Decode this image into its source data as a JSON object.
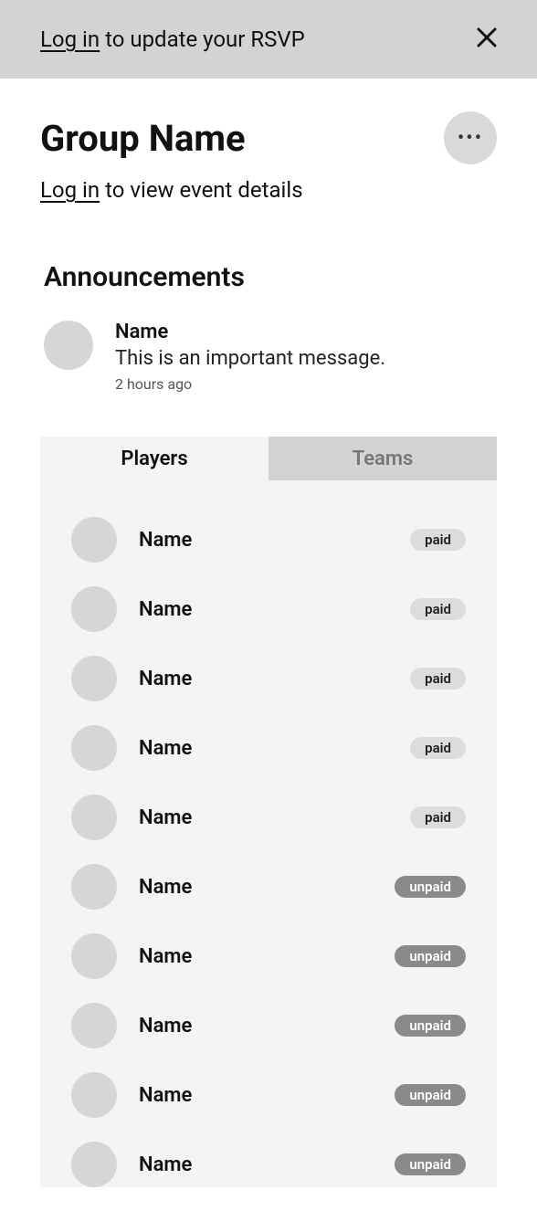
{
  "banner": {
    "login_text": "Log in",
    "rest_text": " to update your RSVP"
  },
  "header": {
    "title": "Group Name",
    "more_icon": "•••"
  },
  "sub": {
    "login_text": "Log in",
    "rest_text": " to view event details"
  },
  "announcements": {
    "title": "Announcements",
    "items": [
      {
        "name": "Name",
        "message": "This is an important message.",
        "time": "2 hours ago"
      }
    ]
  },
  "tabs": {
    "players": "Players",
    "teams": "Teams"
  },
  "players": [
    {
      "name": "Name",
      "status": "paid"
    },
    {
      "name": "Name",
      "status": "paid"
    },
    {
      "name": "Name",
      "status": "paid"
    },
    {
      "name": "Name",
      "status": "paid"
    },
    {
      "name": "Name",
      "status": "paid"
    },
    {
      "name": "Name",
      "status": "unpaid"
    },
    {
      "name": "Name",
      "status": "unpaid"
    },
    {
      "name": "Name",
      "status": "unpaid"
    },
    {
      "name": "Name",
      "status": "unpaid"
    },
    {
      "name": "Name",
      "status": "unpaid"
    }
  ]
}
